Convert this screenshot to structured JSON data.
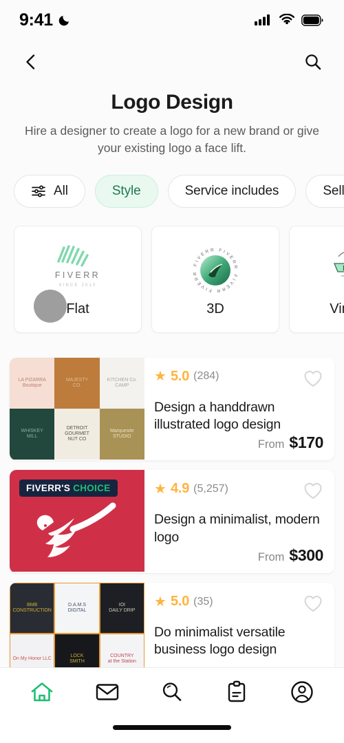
{
  "status_bar": {
    "time": "9:41",
    "dnd_icon": "moon-icon",
    "signal_icon": "cellular-signal-icon",
    "wifi_icon": "wifi-icon",
    "battery_icon": "battery-full-icon"
  },
  "nav": {
    "back_icon": "chevron-left-icon",
    "search_icon": "search-icon"
  },
  "header": {
    "title": "Logo Design",
    "subtitle": "Hire a designer to create a logo for a new brand or give your existing logo a face lift."
  },
  "filters": {
    "chips": [
      {
        "label": "All",
        "icon": "sliders-icon",
        "active": false
      },
      {
        "label": "Style",
        "icon": "",
        "active": true
      },
      {
        "label": "Service includes",
        "icon": "",
        "active": false
      },
      {
        "label": "Seller",
        "icon": "",
        "active": false
      }
    ]
  },
  "styles": {
    "cards": [
      {
        "label": "Flat",
        "art": "fiverr-wordmark-logo",
        "cursor": true
      },
      {
        "label": "3D",
        "art": "fiverr-3d-badge-logo",
        "cursor": false
      },
      {
        "label": "Vintage",
        "art": "fiverr-vintage-crest-logo",
        "cursor": false
      }
    ]
  },
  "gigs": [
    {
      "rating": "5.0",
      "reviews": "(284)",
      "title": "Design a handdrawn illustrated logo design",
      "from_label": "From",
      "price": "$170",
      "favorite_icon": "heart-outline-icon",
      "badge": "",
      "thumb_type": "collage-light",
      "thumb_cells": [
        {
          "bg": "#f6ded5",
          "fg": "#b0705e",
          "mark": "LA PIZARRA\nBoutique"
        },
        {
          "bg": "#bd7b3c",
          "fg": "#e4c49f",
          "mark": "MAJESTY\nCO."
        },
        {
          "bg": "#f3f2ee",
          "fg": "#9a9a92",
          "mark": "KITCHEN Co.\nCAMP"
        },
        {
          "bg": "#22473c",
          "fg": "#9ec0b0",
          "mark": "WHISKEY\nMILL"
        },
        {
          "bg": "#f1ece1",
          "fg": "#3a3a36",
          "mark": "DETROIT GOURMET\nNUT CO"
        },
        {
          "bg": "#a99255",
          "fg": "#f6f0df",
          "mark": "Marquesite\nSTUDIO"
        }
      ]
    },
    {
      "rating": "4.9",
      "reviews": "(5,257)",
      "title": "Design a minimalist, modern logo",
      "from_label": "From",
      "price": "$300",
      "favorite_icon": "heart-outline-icon",
      "badge": "FIVERR'S CHOICE",
      "badge_part_1": "FIVERR'S",
      "badge_part_2": "CHOICE",
      "thumb_type": "red-eagle",
      "thumb_cells": []
    },
    {
      "rating": "5.0",
      "reviews": "(35)",
      "title": "Do minimalist versatile business logo design",
      "from_label": "From",
      "price": "",
      "favorite_icon": "heart-outline-icon",
      "badge": "",
      "thumb_type": "collage-dark",
      "thumb_cells": [
        {
          "bg": "#2a2c33",
          "fg": "#e9c53c",
          "mark": "BMB\nCONSTRUCTION"
        },
        {
          "bg": "#f4f5f7",
          "fg": "#1c2b4a",
          "mark": "D.A.M.S DIGITAL"
        },
        {
          "bg": "#1d1f24",
          "fg": "#efe7d2",
          "mark": "IOI\nDAILY DRIP"
        },
        {
          "bg": "#f2f2f4",
          "fg": "#c0392b",
          "mark": "On My Honor LLC"
        },
        {
          "bg": "#17181c",
          "fg": "#e9c53c",
          "mark": "LOCK\nSMITH"
        },
        {
          "bg": "#f4f4f6",
          "fg": "#b02a37",
          "mark": "COUNTRY\nat the Station"
        }
      ]
    }
  ],
  "tabbar": {
    "items": [
      {
        "icon": "home-icon",
        "active": true
      },
      {
        "icon": "mail-icon",
        "active": false
      },
      {
        "icon": "search-icon",
        "active": false
      },
      {
        "icon": "orders-clipboard-icon",
        "active": false
      },
      {
        "icon": "profile-icon",
        "active": false
      }
    ]
  },
  "colors": {
    "accent_green": "#1dbf73",
    "star_amber": "#ffb33e",
    "choice_red": "#cf3048",
    "badge_navy": "#18243f"
  }
}
